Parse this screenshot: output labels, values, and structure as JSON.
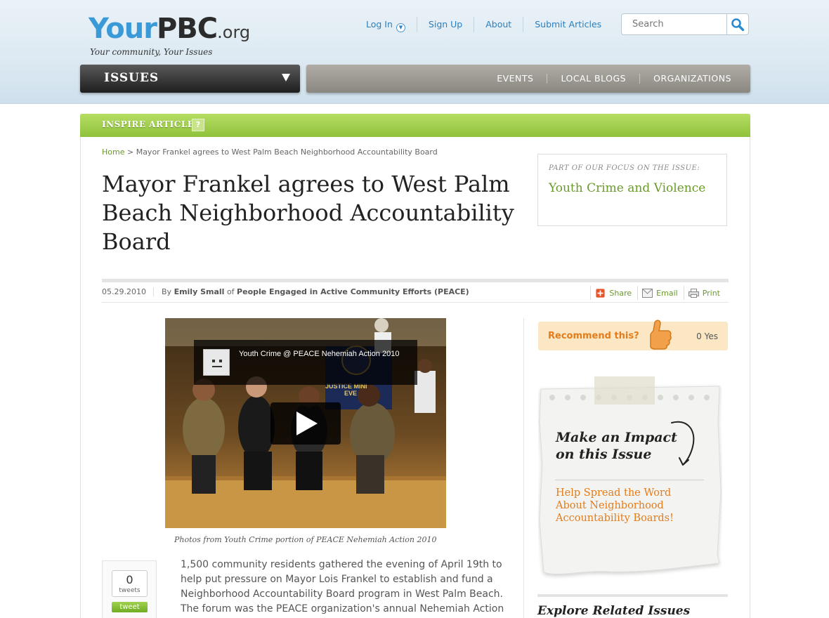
{
  "header": {
    "logo": {
      "your": "Your",
      "pbc": "PBC",
      "org": ".org",
      "tagline": "Your community, Your Issues"
    },
    "links": [
      {
        "label": "Log In",
        "name": "log-in-link"
      },
      {
        "label": "Sign Up",
        "name": "sign-up-link"
      },
      {
        "label": "About",
        "name": "about-link"
      },
      {
        "label": "Submit Articles",
        "name": "submit-articles-link"
      }
    ],
    "search": {
      "placeholder": "Search",
      "icon": "search-icon"
    }
  },
  "nav": {
    "issues_label": "ISSUES",
    "items": [
      "EVENTS",
      "LOCAL BLOGS",
      "ORGANIZATIONS"
    ]
  },
  "article": {
    "section_label": "INSPIRE ARTICLE",
    "help_label": "?",
    "breadcrumb": {
      "home": "Home",
      "separator": ">",
      "current": "Mayor Frankel agrees to West Palm Beach Neighborhood Accountability Board"
    },
    "title": "Mayor Frankel agrees to West Palm Beach Neighborhood Accountability Board",
    "focus": {
      "label": "Part of our focus on the issue:",
      "issue": "Youth Crime and Violence"
    },
    "meta": {
      "date": "05.29.2010",
      "by": "By",
      "author": "Emily Small",
      "of": "of",
      "organization": "People Engaged in Active Community Efforts (PEACE)"
    },
    "actions": [
      {
        "label": "Share",
        "icon": "share-icon"
      },
      {
        "label": "Email",
        "icon": "email-icon"
      },
      {
        "label": "Print",
        "icon": "print-icon"
      }
    ],
    "video": {
      "title": "Youth Crime @ PEACE Nehemiah Action 2010",
      "banner_text": "JUSTICE MINI",
      "banner_text2": "EVE"
    },
    "caption": "Photos from Youth Crime portion of PEACE Nehemiah Action 2010",
    "tweet": {
      "count": "0",
      "count_label": "tweets",
      "button": "tweet"
    },
    "body": "1,500 community residents gathered the evening of April 19th to help put pressure on Mayor Lois Frankel to establish and fund a Neighborhood Accountability Board program in West Palm Beach. The forum was the PEACE organization's annual Nehemiah Action"
  },
  "sidebar": {
    "recommend": {
      "label": "Recommend this?",
      "count": "0 Yes"
    },
    "impact": {
      "title_line1": "Make an Impact",
      "title_line2": "on this Issue",
      "link": "Help Spread the Word About Neighborhood Accountability Boards!"
    },
    "related_title": "Explore Related Issues"
  },
  "colors": {
    "accent_blue": "#2a7fbf",
    "accent_green": "#6a9a2a",
    "accent_orange": "#e37c1b",
    "green_bar": "#9ccc48"
  }
}
